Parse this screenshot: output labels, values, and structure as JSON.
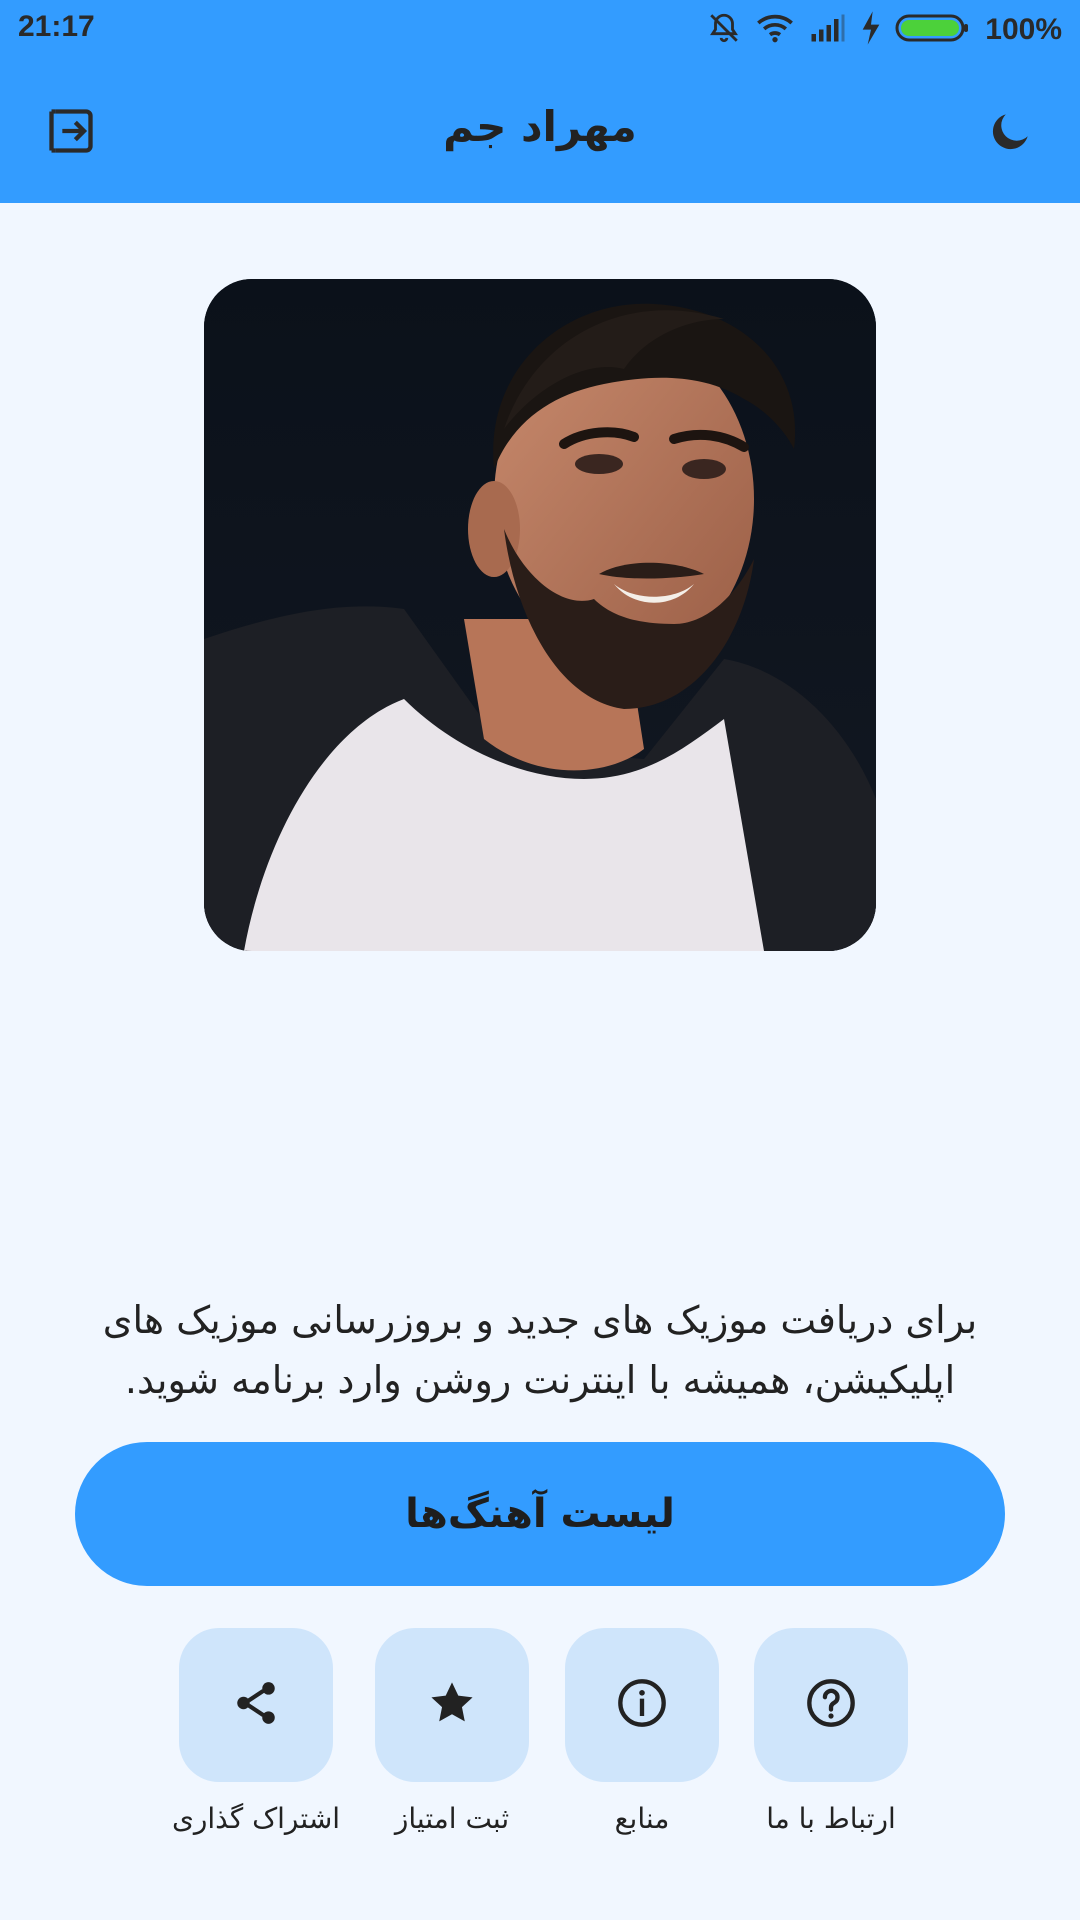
{
  "status_bar": {
    "time": "21:17",
    "battery": "100%",
    "icons": [
      "mute-bell-icon",
      "wifi-icon",
      "signal-icon",
      "charging-icon",
      "battery-icon"
    ]
  },
  "app_bar": {
    "title": "مهراد جم",
    "left_icon": "exit-icon",
    "right_icon": "moon-icon"
  },
  "artist": {
    "image": "artist-photo"
  },
  "info": {
    "text": "برای دریافت موزیک های جدید و بروزرسانی موزیک های اپلیکیشن، همیشه با اینترنت روشن وارد برنامه شوید."
  },
  "main_button": {
    "label": "لیست آهنگ‌ها"
  },
  "actions": [
    {
      "label": "اشتراک گذاری",
      "icon": "share-icon"
    },
    {
      "label": "ثبت امتیاز",
      "icon": "star-icon"
    },
    {
      "label": "منابع",
      "icon": "info-icon"
    },
    {
      "label": "ارتباط با ما",
      "icon": "help-icon"
    }
  ],
  "colors": {
    "primary": "#339cff",
    "background": "#f1f7ff",
    "tile": "#cfe5fb",
    "text": "#222222"
  }
}
